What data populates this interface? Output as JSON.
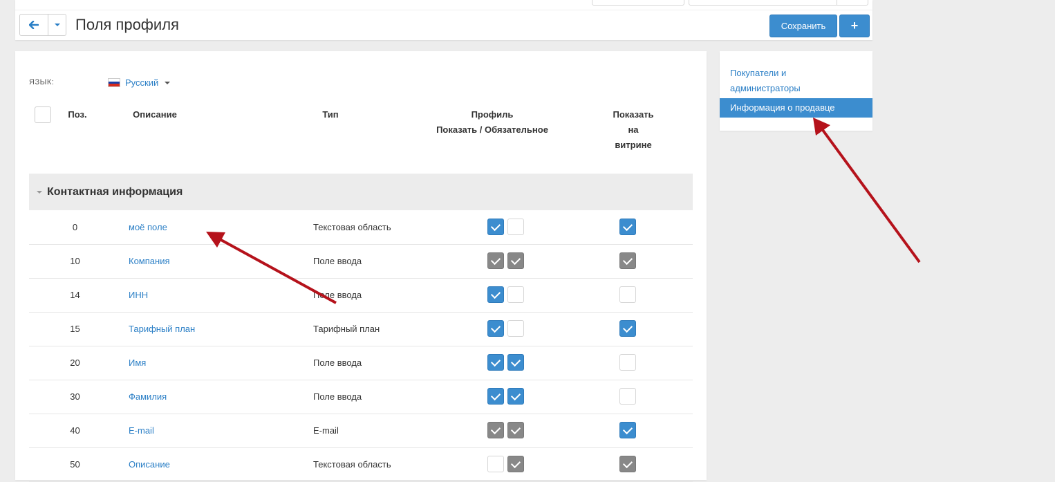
{
  "header": {
    "title": "Поля профиля",
    "save_label": "Сохранить",
    "add_label": "+"
  },
  "language": {
    "label": "ЯЗЫК:",
    "selected": "Русский"
  },
  "table": {
    "headers": {
      "pos": "Поз.",
      "description": "Описание",
      "type": "Тип",
      "profile_line1": "Профиль",
      "profile_line2": "Показать / Обязательное",
      "storefront_line1": "Показать",
      "storefront_line2": "на",
      "storefront_line3": "витрине"
    },
    "group": "Контактная информация",
    "rows": [
      {
        "pos": "0",
        "desc": "моё поле",
        "type": "Текстовая область",
        "show": "blue",
        "required": "empty",
        "storefront": "blue"
      },
      {
        "pos": "10",
        "desc": "Компания",
        "type": "Поле ввода",
        "show": "grey",
        "required": "grey",
        "storefront": "grey"
      },
      {
        "pos": "14",
        "desc": "ИНН",
        "type": "Поле ввода",
        "show": "blue",
        "required": "empty",
        "storefront": "empty"
      },
      {
        "pos": "15",
        "desc": "Тарифный план",
        "type": "Тарифный план",
        "show": "blue",
        "required": "empty",
        "storefront": "blue"
      },
      {
        "pos": "20",
        "desc": "Имя",
        "type": "Поле ввода",
        "show": "blue",
        "required": "blue",
        "storefront": "empty"
      },
      {
        "pos": "30",
        "desc": "Фамилия",
        "type": "Поле ввода",
        "show": "blue",
        "required": "blue",
        "storefront": "empty"
      },
      {
        "pos": "40",
        "desc": "E-mail",
        "type": "E-mail",
        "show": "grey",
        "required": "grey",
        "storefront": "blue"
      },
      {
        "pos": "50",
        "desc": "Описание",
        "type": "Текстовая область",
        "show": "empty",
        "required": "grey",
        "storefront": "grey"
      }
    ]
  },
  "sidebar": {
    "items": [
      {
        "label_line1": "Покупатели и",
        "label_line2": "администраторы",
        "active": false
      },
      {
        "label_line1": "Информация о продавце",
        "active": true
      }
    ]
  },
  "colors": {
    "accent": "#3c8dcf",
    "link": "#2b7fc6",
    "annotation_arrow": "#b5121b",
    "checkbox_grey": "#888888"
  },
  "icons": {
    "back": "arrow-left-icon",
    "dropdown": "caret-down-icon",
    "check": "check-icon",
    "flag": "russia-flag-icon"
  }
}
